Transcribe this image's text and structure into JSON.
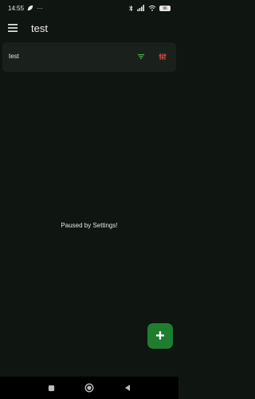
{
  "status_bar": {
    "time": "14:55",
    "more": "···",
    "battery": "96",
    "icons": [
      "leaf-icon",
      "bluetooth-icon",
      "cellular-icon",
      "wifi-icon",
      "battery-icon"
    ]
  },
  "app_bar": {
    "title": "test",
    "menu_icon": "menu-icon"
  },
  "list": {
    "items": [
      {
        "label": "test",
        "icons": [
          "filter-icon",
          "tune-icon"
        ]
      }
    ]
  },
  "main": {
    "message": "Paused by Settings!"
  },
  "fab": {
    "label": "+",
    "color": "#1f7d2f"
  },
  "nav_bar": {
    "buttons": [
      "recents-button",
      "home-button",
      "back-button"
    ]
  },
  "colors": {
    "background": "#0f1511",
    "card": "#1a211c",
    "accent_green": "#3fbf4f",
    "accent_red": "#e0483b"
  }
}
